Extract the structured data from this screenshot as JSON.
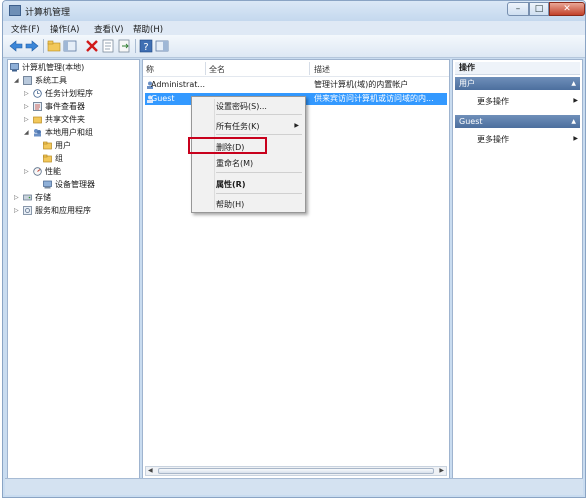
{
  "window": {
    "title": "计算机管理"
  },
  "menubar": [
    "文件(F)",
    "操作(A)",
    "查看(V)",
    "帮助(H)"
  ],
  "tree": {
    "root": "计算机管理(本地)",
    "system_tools": "系统工具",
    "task_scheduler": "任务计划程序",
    "event_viewer": "事件查看器",
    "shared_folders": "共享文件夹",
    "local_users_groups": "本地用户和组",
    "users": "用户",
    "groups": "组",
    "performance": "性能",
    "device_manager": "设备管理器",
    "storage": "存储",
    "services_apps": "服务和应用程序"
  },
  "list": {
    "columns": [
      "称",
      "全名",
      "描述"
    ],
    "rows": [
      {
        "name": "Administrat...",
        "fullname": "",
        "desc": "管理计算机(域)的内置帐户"
      },
      {
        "name": "Guest",
        "fullname": "",
        "desc": "供来宾访问计算机或访问域的内..."
      }
    ]
  },
  "context_menu": {
    "set_password": "设置密码(S)...",
    "all_tasks": "所有任务(K)",
    "delete": "删除(D)",
    "rename": "重命名(M)",
    "properties": "属性(R)",
    "help": "帮助(H)"
  },
  "actions": {
    "header": "操作",
    "section1": "用户",
    "section1_item": "更多操作",
    "section2": "Guest",
    "section2_item": "更多操作"
  },
  "colors": {
    "selection": "#3399ff",
    "highlight_box": "#c8001c"
  }
}
